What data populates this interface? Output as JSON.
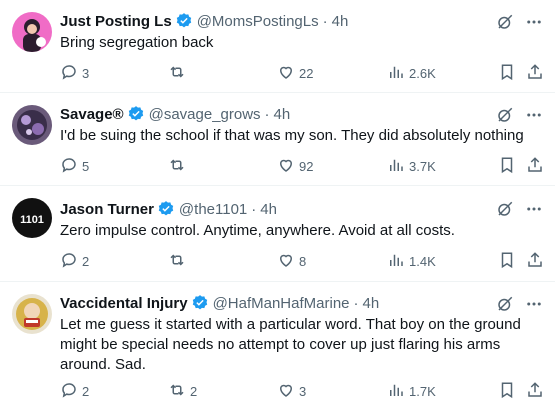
{
  "colors": {
    "verified": "#1d9bf0",
    "secondary_text": "#536471",
    "primary_text": "#0f1419",
    "divider": "#eff3f4"
  },
  "icons": {
    "verified": "verified-badge-icon",
    "grok": "grok-icon",
    "more": "more-icon",
    "reply": "reply-icon",
    "retweet": "retweet-icon",
    "like": "like-icon",
    "views": "views-icon",
    "bookmark": "bookmark-icon",
    "share": "share-icon"
  },
  "tweets": [
    {
      "name": "Just Posting Ls",
      "handle": "@MomsPostingLs",
      "separator": "·",
      "time": "4h",
      "text": "Bring segregation back",
      "replies": "3",
      "retweets": "",
      "likes": "22",
      "views": "2.6K"
    },
    {
      "name": "Savage®",
      "handle": "@savage_grows",
      "separator": "·",
      "time": "4h",
      "text": "I'd be suing the school if that was my son. They did absolutely nothing",
      "replies": "5",
      "retweets": "",
      "likes": "92",
      "views": "3.7K"
    },
    {
      "name": "Jason Turner",
      "handle": "@the1101",
      "separator": "·",
      "time": "4h",
      "text": "Zero impulse control. Anytime, anywhere. Avoid at all costs.",
      "replies": "2",
      "retweets": "",
      "likes": "8",
      "views": "1.4K"
    },
    {
      "name": "Vaccidental Injury",
      "handle": "@HafManHafMarine",
      "separator": "·",
      "time": "4h",
      "text": "Let me guess it started with a particular word.  That boy on the ground might be special needs no attempt to cover up just flaring his arms around. Sad.",
      "replies": "2",
      "retweets": "2",
      "likes": "3",
      "views": "1.7K"
    }
  ]
}
